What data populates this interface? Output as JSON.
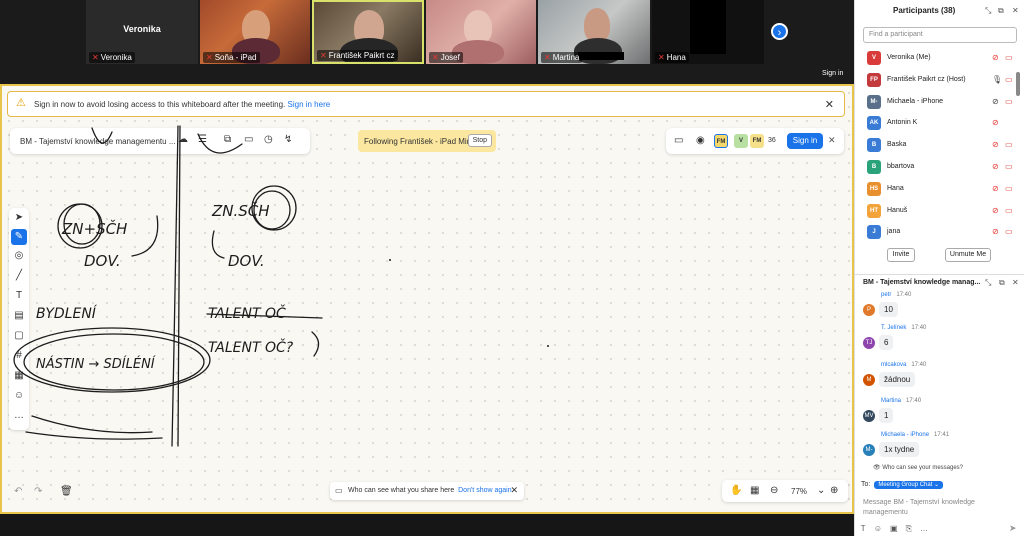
{
  "video": {
    "tiles": [
      {
        "key": "veronika",
        "display": "Veronika",
        "label": "Veronika"
      },
      {
        "key": "sona",
        "label": "Soňa - iPad"
      },
      {
        "key": "frantisek",
        "label": "František Paikrt cz"
      },
      {
        "key": "josef",
        "label": "Josef"
      },
      {
        "key": "martina",
        "label": "Martina"
      },
      {
        "key": "hana",
        "label": "Hana"
      }
    ],
    "sign_in": "Sign in"
  },
  "banner": {
    "text": "Sign in now to avoid losing access to this whiteboard after the meeting.",
    "link": "Sign in here"
  },
  "toolbar": {
    "title": "BM - Tajemství knowledge managementu ..."
  },
  "following": {
    "text": "Following František - iPad Mini",
    "stop": "Stop"
  },
  "right_toolbar": {
    "avatars": [
      {
        "initials": "FM",
        "color": "#f2d86b"
      },
      {
        "initials": "V",
        "color": "#b8e0a2"
      },
      {
        "initials": "FM",
        "color": "#f7e08a"
      }
    ],
    "count": "36",
    "sign_in": "Sign in"
  },
  "canvas": {
    "handwriting": [
      "ZN+SČH",
      "DOV.",
      "ZN.SČH",
      "DOV.",
      "BYDLENÍ",
      "TALENT OČ",
      "TALENT OČ?",
      "NÁSTIN → SDÍLÉNÍ"
    ]
  },
  "bottom": {
    "message": "Who can see what you share here",
    "dismiss": "Don't show again",
    "zoom": "77%"
  },
  "participants": {
    "title": "Participants (38)",
    "search_placeholder": "Find a participant",
    "list": [
      {
        "initials": "V",
        "name": "Veronika (Me)",
        "color": "#d93a3a"
      },
      {
        "initials": "FP",
        "name": "František Paikrt cz (Host)",
        "color": "#c4393c"
      },
      {
        "initials": "M-",
        "name": "Michaela - iPhone",
        "color": "#5a6f8a"
      },
      {
        "initials": "AK",
        "name": "Antonin K",
        "color": "#3a7bd5"
      },
      {
        "initials": "B",
        "name": "Baska",
        "color": "#3a7bd5"
      },
      {
        "initials": "B",
        "name": "bbartova",
        "color": "#2aa37a"
      },
      {
        "initials": "HS",
        "name": "Hana",
        "color": "#e8902f"
      },
      {
        "initials": "HT",
        "name": "Hanuš",
        "color": "#f2a33a"
      },
      {
        "initials": "J",
        "name": "jana",
        "color": "#3a7bd5"
      }
    ],
    "invite": "Invite",
    "unmute": "Unmute Me"
  },
  "chat": {
    "title": "BM - Tajemství knowledge manag...",
    "messages": [
      {
        "initials": "P",
        "sender": "petr",
        "time": "17:40",
        "text": "10",
        "color": "#e07a2a"
      },
      {
        "initials": "TJ",
        "sender": "T. Jelínek",
        "time": "17:40",
        "text": "6",
        "color": "#8e44ad"
      },
      {
        "initials": "M",
        "sender": "mlcakova",
        "time": "17:40",
        "text": "žádnou",
        "color": "#d35400"
      },
      {
        "initials": "MV",
        "sender": "Martina",
        "time": "17:40",
        "text": "1",
        "color": "#34495e"
      },
      {
        "initials": "M-",
        "sender": "Michaela - iPhone",
        "time": "17:41",
        "text": "1x tydne",
        "color": "#2980b9"
      }
    ],
    "who_can_see": "Who can see your messages?",
    "to_label": "To:",
    "to_value": "Meeting Group Chat",
    "placeholder": "Message BM - Tajemství knowledge managementu"
  }
}
